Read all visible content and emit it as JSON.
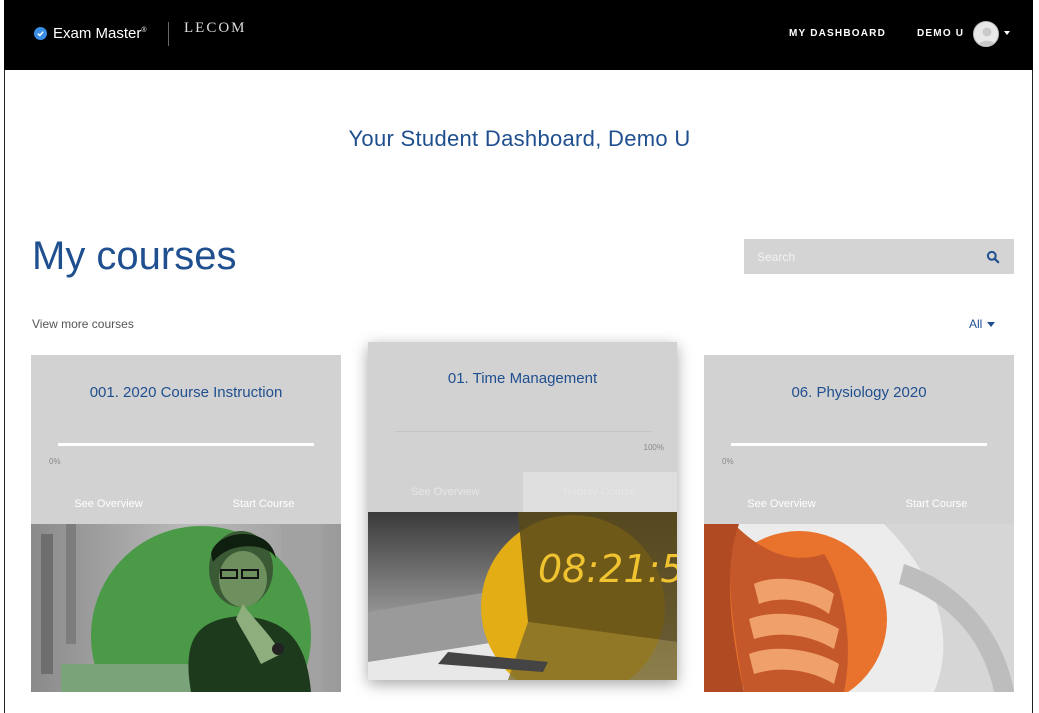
{
  "header": {
    "brand": "Exam Master",
    "brand_mark": "®",
    "partner_name": "LECOM",
    "nav_dashboard": "MY DASHBOARD",
    "user_name": "DEMO U"
  },
  "welcome": "Your Student Dashboard, Demo U",
  "courses_title": "My courses",
  "search": {
    "placeholder": "Search"
  },
  "view_more": "View more courses",
  "filter": {
    "selected": "All"
  },
  "courses": [
    {
      "title": "001. 2020 Course Instruction",
      "progress_label": "0%",
      "progress": 0,
      "actions": [
        "See Overview",
        "Start Course"
      ],
      "accent": "#3f9a3f"
    },
    {
      "title": "01. Time Management",
      "progress_label": "100%",
      "progress": 100,
      "actions": [
        "See Overview",
        "Replay Course"
      ],
      "accent": "#e3ad16",
      "image_text": "08:21:5"
    },
    {
      "title": "06. Physiology 2020",
      "progress_label": "0%",
      "progress": 0,
      "actions": [
        "See Overview",
        "Start Course"
      ],
      "accent": "#e9732c"
    }
  ],
  "colors": {
    "primary": "#1f4f8f",
    "topbar": "#000000",
    "card": "#d2d2d2"
  }
}
